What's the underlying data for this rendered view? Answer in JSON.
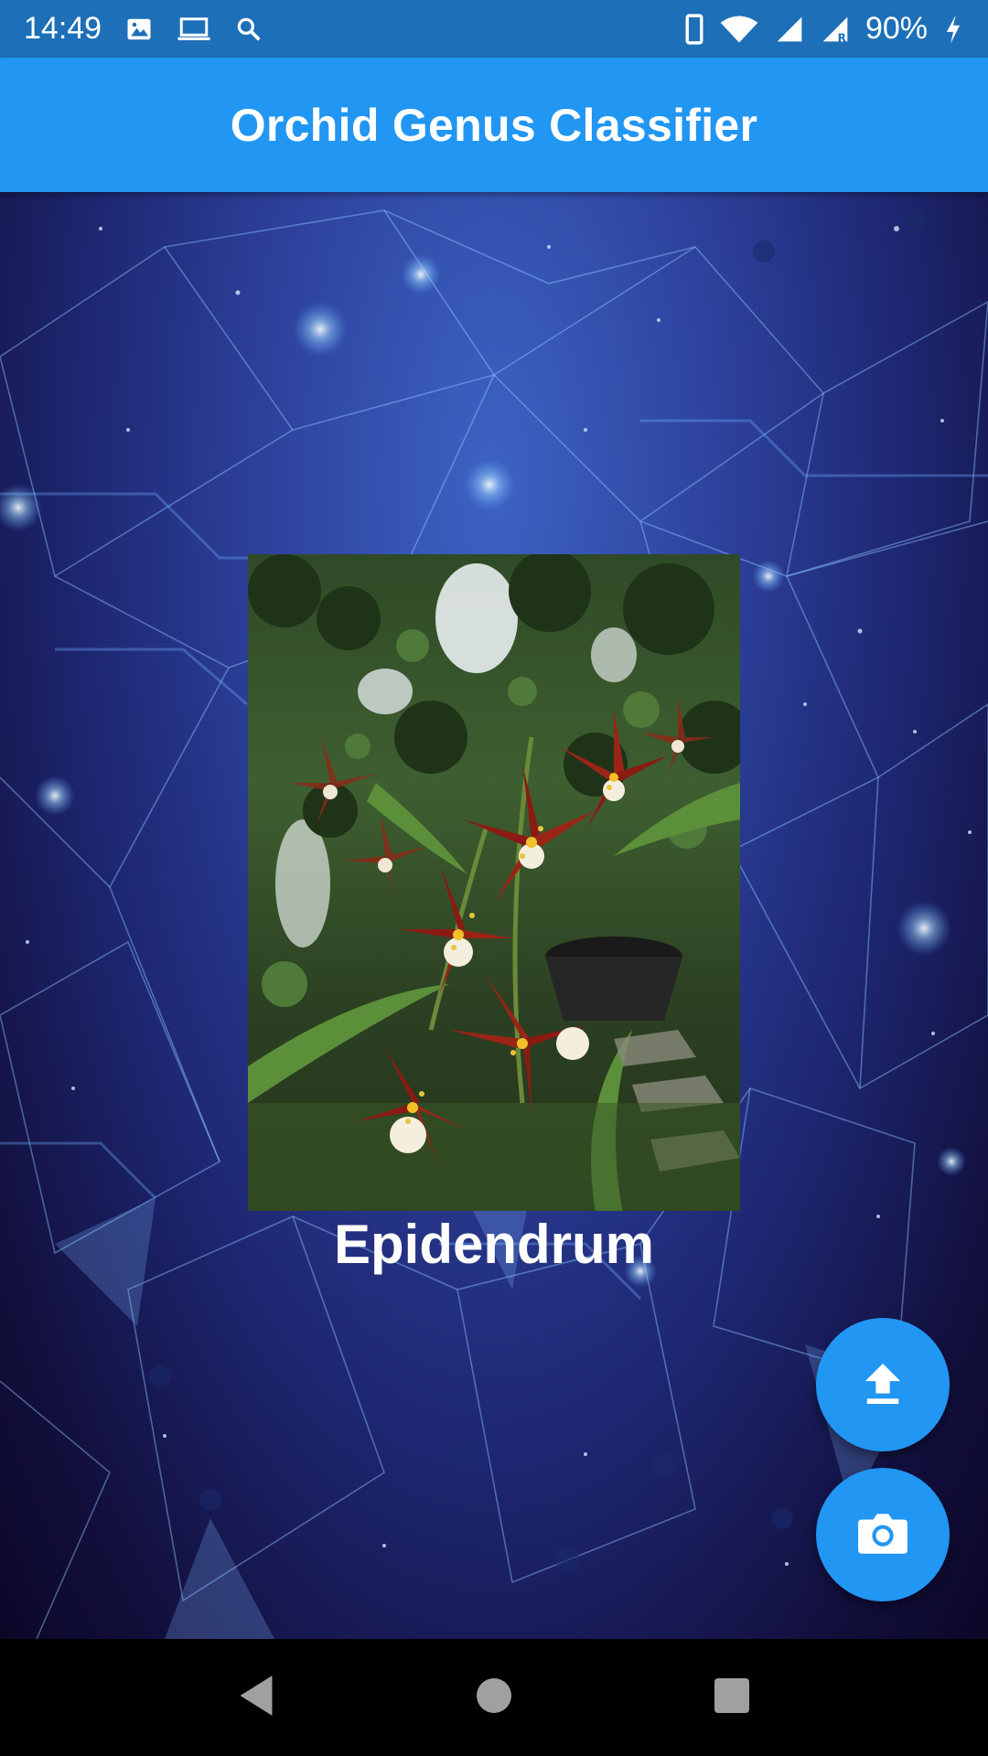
{
  "status_bar": {
    "time": "14:49",
    "battery_percent": "90%",
    "icons_left": [
      "image-icon",
      "laptop-icon",
      "search-icon"
    ],
    "icons_right": [
      "phone-icon",
      "wifi-icon",
      "signal-icon",
      "signal-roaming-icon",
      "battery-charging-icon"
    ]
  },
  "app_bar": {
    "title": "Orchid Genus Classifier",
    "color": "#2196f3"
  },
  "result": {
    "image_subject": "orchid-photo",
    "label": "Epidendrum"
  },
  "fabs": [
    {
      "icon": "upload-icon"
    },
    {
      "icon": "camera-icon"
    }
  ],
  "nav_bar": {
    "buttons": [
      "back-icon",
      "home-icon",
      "recents-icon"
    ]
  },
  "colors": {
    "status_bar": "#1d6fb8",
    "accent": "#2196f3",
    "label_text": "#ffffff"
  }
}
